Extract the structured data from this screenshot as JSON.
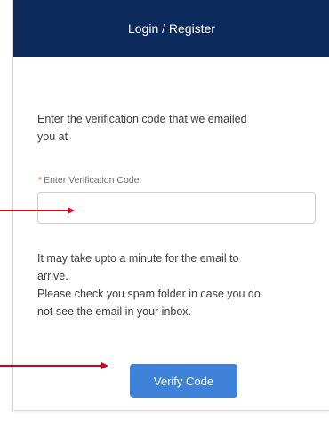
{
  "header": {
    "title": "Login / Register"
  },
  "intro": {
    "line1": "Enter the verification code that we emailed",
    "line2": "you at"
  },
  "field": {
    "required_marker": "*",
    "label": "Enter Verification Code",
    "value": "",
    "placeholder": ""
  },
  "help": {
    "line1": "It may take upto a minute for the email to",
    "line2": "arrive.",
    "line3": "Please check you spam folder in case you do",
    "line4": "not see the email in your inbox."
  },
  "verify_button": {
    "label": "Verify Code"
  },
  "colors": {
    "header_bg": "#0d2a5c",
    "button_bg": "#3f82d9",
    "annotation_arrow": "#d0021b",
    "required_marker": "#c23934"
  }
}
